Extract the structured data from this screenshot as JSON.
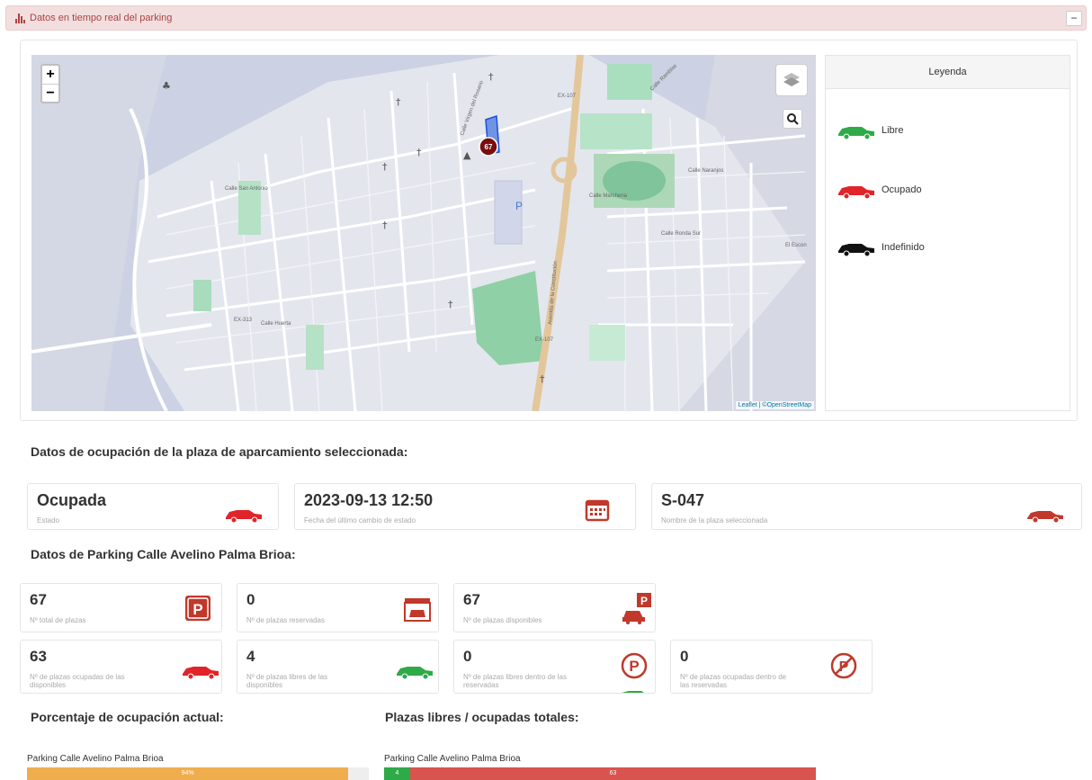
{
  "panel": {
    "title": "Datos en tiempo real del parking",
    "collapse_label": "−"
  },
  "map": {
    "zoom_in": "+",
    "zoom_out": "−",
    "marker_label": "67",
    "attribution": "Leaflet | ©OpenStreetMap",
    "street_labels": [
      "EX-107",
      "EX-107",
      "EX-313",
      "Calle Ramblas",
      "Calle Huerta",
      "Calle Ronda Sur",
      "Calle Marchena",
      "Calle Virgen del Rosario",
      "Calle San Antonio",
      "Calle Naranjos",
      "Avenida de la Constitución",
      "El Escon"
    ]
  },
  "legend": {
    "title": "Leyenda",
    "items": [
      {
        "label": "Libre",
        "color": "#2eaa48"
      },
      {
        "label": "Ocupado",
        "color": "#e0242a"
      },
      {
        "label": "Indefinido",
        "color": "#111111"
      }
    ]
  },
  "selected": {
    "heading": "Datos de ocupación de la plaza de aparcamiento seleccionada:",
    "cards": [
      {
        "value": "Ocupada",
        "label": "Estado",
        "icon": "car-icon"
      },
      {
        "value": "2023-09-13 12:50",
        "label": "Fecha del último cambio de estado",
        "icon": "calendar-icon"
      },
      {
        "value": "S-047",
        "label": "Nombre de la plaza seleccionada",
        "icon": "car-icon"
      }
    ]
  },
  "parking": {
    "heading": "Datos de Parking Calle Avelino Palma Brioa:",
    "stats": [
      {
        "value": "67",
        "label": "Nº total de plazas",
        "icon": "parking-sign-icon"
      },
      {
        "value": "0",
        "label": "Nº de plazas reservadas",
        "icon": "garage-icon"
      },
      {
        "value": "67",
        "label": "Nº de plazas disponibles",
        "icon": "car-parking-icon"
      },
      {
        "value": "63",
        "label": "Nº de plazas ocupadas de las disponibles",
        "icon": "red-car-icon"
      },
      {
        "value": "4",
        "label": "Nº de plazas libres de las disponibles",
        "icon": "green-car-icon"
      },
      {
        "value": "0",
        "label": "Nº de plazas libres dentro de las reservadas",
        "icon": "parking-circle-icon"
      },
      {
        "value": "0",
        "label": "Nº de plazas ocupadas dentro de las reservadas",
        "icon": "no-parking-icon"
      }
    ]
  },
  "occupancy": {
    "heading": "Porcentaje de ocupación actual:",
    "bar_label": "Parking Calle Avelino Palma Brioa",
    "percent": 94,
    "percent_text": "94%"
  },
  "totals": {
    "heading": "Plazas libres / ocupadas totales:",
    "bar_label": "Parking Calle Avelino Palma Brioa",
    "free": 4,
    "occupied": 63,
    "free_text": "4",
    "occupied_text": "63"
  },
  "colors": {
    "free": "#2eaa48",
    "occupied": "#d9534f",
    "occupancy": "#f0ad4e",
    "icon_red": "#c0392b"
  }
}
